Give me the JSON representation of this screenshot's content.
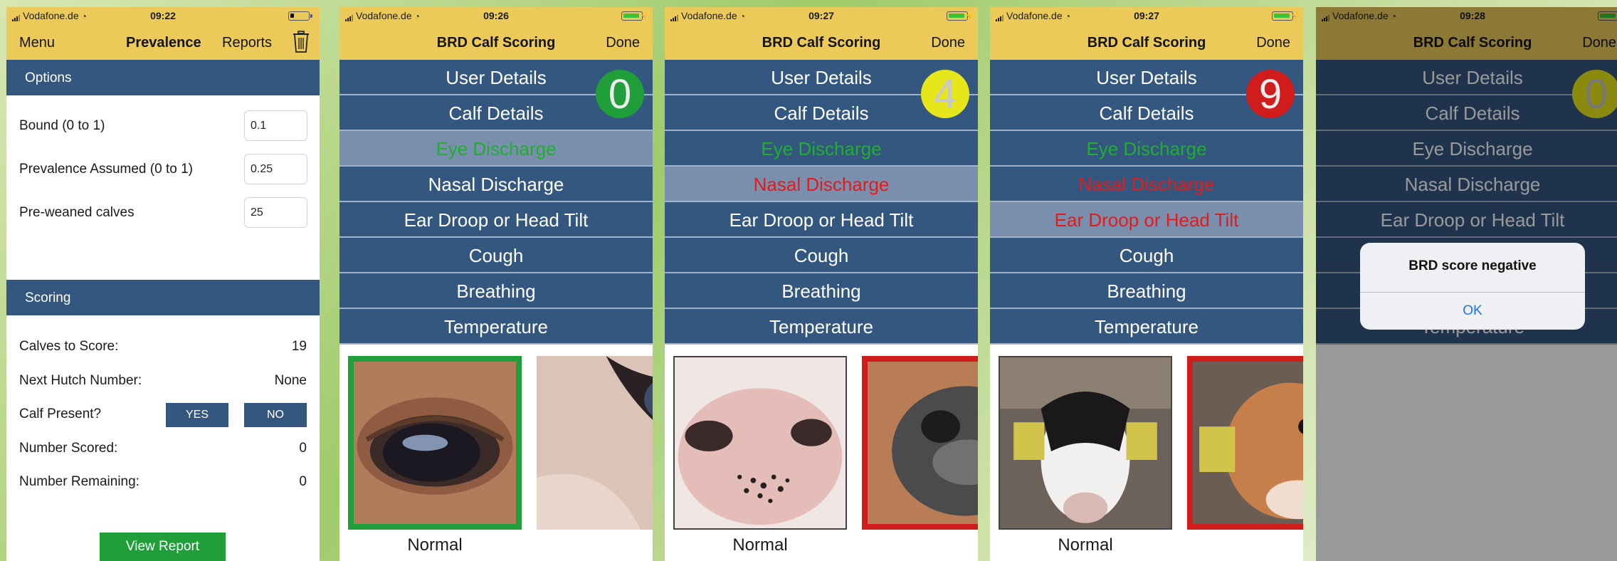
{
  "status": {
    "carrier": "Vodafone.de",
    "times": [
      "09:22",
      "09:26",
      "09:27",
      "09:27",
      "09:28"
    ]
  },
  "screen1": {
    "nav": {
      "menu": "Menu",
      "title": "Prevalence",
      "reports": "Reports"
    },
    "options_header": "Options",
    "options": [
      {
        "label": "Bound (0 to 1)",
        "value": "0.1"
      },
      {
        "label": "Prevalence Assumed (0 to 1)",
        "value": "0.25"
      },
      {
        "label": "Pre-weaned calves",
        "value": "25"
      }
    ],
    "scoring_header": "Scoring",
    "scoring": {
      "calves_to_score_label": "Calves to Score:",
      "calves_to_score_value": "19",
      "next_hutch_label": "Next Hutch Number:",
      "next_hutch_value": "None",
      "calf_present_label": "Calf Present?",
      "yes_label": "YES",
      "no_label": "NO",
      "number_scored_label": "Number Scored:",
      "number_scored_value": "0",
      "number_remaining_label": "Number Remaining:",
      "number_remaining_value": "0"
    },
    "view_report_label": "View Report"
  },
  "scoring_nav": {
    "title": "BRD Calf Scoring",
    "done": "Done"
  },
  "menu_items": [
    "User Details",
    "Calf Details",
    "Eye Discharge",
    "Nasal Discharge",
    "Ear Droop or Head Tilt",
    "Cough",
    "Breathing",
    "Temperature"
  ],
  "scores": {
    "screen2": "0",
    "screen3": "4",
    "screen4": "9",
    "screen5": "0"
  },
  "colors": {
    "navbar": "#ecca5a",
    "section_blue": "#34577f",
    "selected_row": "#7a8fae",
    "green": "#1f9e3a",
    "yellow": "#e6e61a",
    "red": "#d11c1c",
    "ios_blue": "#1a73e8"
  },
  "photo_label": "Normal",
  "alert": {
    "title": "BRD score negative",
    "ok": "OK"
  }
}
